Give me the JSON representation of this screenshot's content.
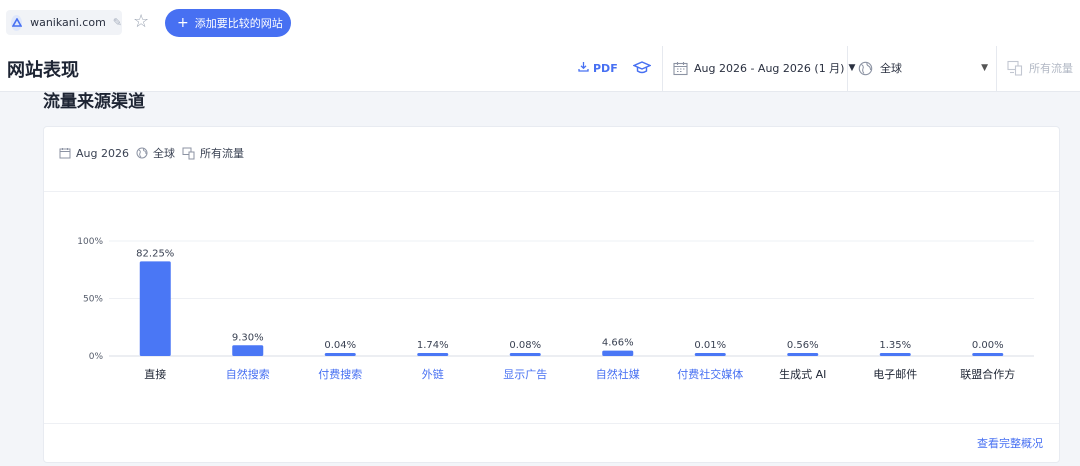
{
  "topbar": {
    "domain": "wanikani.com",
    "add_button_label": "添加要比较的网站"
  },
  "header": {
    "page_title": "网站表现",
    "pdf_label": "PDF",
    "date_range": "Aug 2026 - Aug 2026 (1 月)",
    "region": "全球",
    "traffic_type": "所有流量"
  },
  "section": {
    "title": "流量来源渠道"
  },
  "card": {
    "filter_date": "Aug 2026",
    "filter_region": "全球",
    "filter_traffic": "所有流量",
    "full_overview_link": "查看完整概况"
  },
  "colors": {
    "accent": "#4770f2",
    "bar": "#4a77f5",
    "link_label": "#4770f2",
    "plain_label": "#1d2433"
  },
  "chart_data": {
    "type": "bar",
    "categories": [
      "直接",
      "自然搜索",
      "付费搜索",
      "外链",
      "显示广告",
      "自然社媒",
      "付费社交媒体",
      "生成式 AI",
      "电子邮件",
      "联盟合作方"
    ],
    "values": [
      82.25,
      9.3,
      0.04,
      1.74,
      0.08,
      4.66,
      0.01,
      0.56,
      1.35,
      0.0
    ],
    "value_labels": [
      "82.25%",
      "9.30%",
      "0.04%",
      "1.74%",
      "0.08%",
      "4.66%",
      "0.01%",
      "0.56%",
      "1.35%",
      "0.00%"
    ],
    "category_is_link": [
      false,
      true,
      true,
      true,
      true,
      true,
      true,
      false,
      false,
      false
    ],
    "yticks": [
      "100%",
      "50%",
      "0%"
    ],
    "ylim": [
      0,
      100
    ],
    "grid": true,
    "legend": "none"
  }
}
